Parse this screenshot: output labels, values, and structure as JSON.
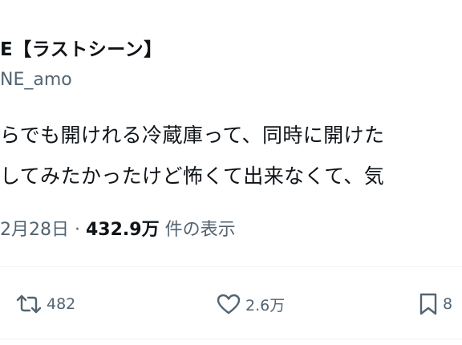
{
  "post": {
    "author_name": "E【ラストシーン】",
    "author_handle": "NE_amo",
    "text_line1": "らでも開けれる冷蔵庫って、同時に開けた",
    "text_line2": "してみたかったけど怖くて出来なくて、気",
    "date": "2月28日",
    "separator": "·",
    "views": "432.9万",
    "views_label": "件の表示"
  },
  "actions": {
    "retweet_icon": "retweet-icon",
    "retweet_count": "482",
    "like_icon": "heart-icon",
    "like_count": "2.6万",
    "bookmark_icon": "bookmark-icon",
    "bookmark_count": "8"
  },
  "colors": {
    "text": "#0f1419",
    "secondary": "#536471",
    "divider": "#eff3f4"
  }
}
